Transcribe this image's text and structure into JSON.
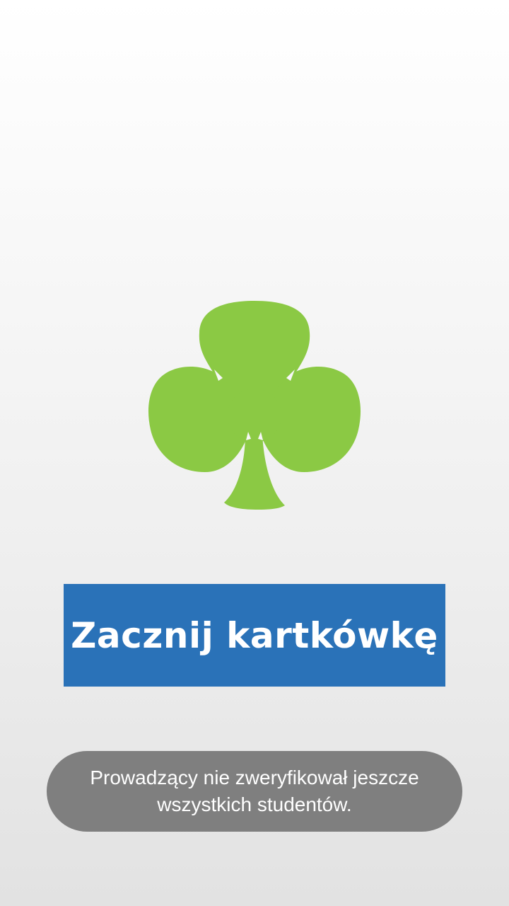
{
  "logo": {
    "icon": "clover-icon",
    "color": "#8bc944"
  },
  "start_button": {
    "label": "Zacznij kartkówkę",
    "color": "#2a72b8"
  },
  "toast": {
    "message": "Prowadzący nie zweryfikował jeszcze\nwszystkich studentów.",
    "color": "#7f7f7f"
  }
}
